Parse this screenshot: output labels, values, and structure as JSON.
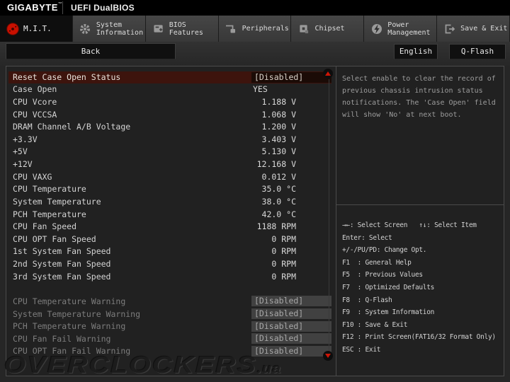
{
  "titlebar": {
    "brand": "GIGABYTE",
    "trademark": "™",
    "title": "UEFI DualBIOS"
  },
  "tabs": [
    {
      "label": "M.I.T.",
      "lines": [
        "M.I.T."
      ],
      "icon": "mit-dial-icon",
      "active": true
    },
    {
      "label": "System Information",
      "lines": [
        "System",
        "Information"
      ],
      "icon": "gear-icon",
      "active": false
    },
    {
      "label": "BIOS Features",
      "lines": [
        "BIOS",
        "Features"
      ],
      "icon": "bios-features-icon",
      "active": false
    },
    {
      "label": "Peripherals",
      "lines": [
        "Peripherals"
      ],
      "icon": "peripherals-icon",
      "active": false
    },
    {
      "label": "Chipset",
      "lines": [
        "Chipset"
      ],
      "icon": "chipset-icon",
      "active": false
    },
    {
      "label": "Power Management",
      "lines": [
        "Power",
        "Management"
      ],
      "icon": "power-icon",
      "active": false
    },
    {
      "label": "Save & Exit",
      "lines": [
        "Save & Exit"
      ],
      "icon": "save-exit-icon",
      "active": false
    }
  ],
  "toolbar": {
    "back": "Back",
    "language": "English",
    "qflash": "Q-Flash"
  },
  "rows": [
    {
      "label": "Reset Case Open Status",
      "value": "[Disabled]",
      "style": "selected"
    },
    {
      "label": "Case Open",
      "value": "YES",
      "style": "plain"
    },
    {
      "label": "CPU Vcore",
      "value": "1.188 V",
      "style": "reading"
    },
    {
      "label": "CPU VCCSA",
      "value": "1.068 V",
      "style": "reading"
    },
    {
      "label": "DRAM Channel A/B Voltage",
      "value": "1.200 V",
      "style": "reading"
    },
    {
      "label": "+3.3V",
      "value": "3.403 V",
      "style": "reading"
    },
    {
      "label": "+5V",
      "value": "5.130 V",
      "style": "reading"
    },
    {
      "label": "+12V",
      "value": "12.168 V",
      "style": "reading"
    },
    {
      "label": "CPU VAXG",
      "value": "0.012 V",
      "style": "reading"
    },
    {
      "label": "CPU Temperature",
      "value": "35.0 °C",
      "style": "reading"
    },
    {
      "label": "System Temperature",
      "value": "38.0 °C",
      "style": "reading"
    },
    {
      "label": "PCH Temperature",
      "value": "42.0 °C",
      "style": "reading"
    },
    {
      "label": "CPU Fan Speed",
      "value": "1188 RPM",
      "style": "reading"
    },
    {
      "label": "CPU OPT Fan Speed",
      "value": "0 RPM",
      "style": "reading"
    },
    {
      "label": "1st System Fan Speed",
      "value": "0 RPM",
      "style": "reading"
    },
    {
      "label": "2nd System Fan Speed",
      "value": "0 RPM",
      "style": "reading"
    },
    {
      "label": "3rd System Fan Speed",
      "value": "0 RPM",
      "style": "reading"
    },
    {
      "label": "",
      "value": "",
      "style": "spacer"
    },
    {
      "label": "CPU Temperature Warning",
      "value": "[Disabled]",
      "style": "boxed"
    },
    {
      "label": "System Temperature Warning",
      "value": "[Disabled]",
      "style": "boxed"
    },
    {
      "label": "PCH Temperature Warning",
      "value": "[Disabled]",
      "style": "boxed"
    },
    {
      "label": "CPU Fan Fail Warning",
      "value": "[Disabled]",
      "style": "boxed"
    },
    {
      "label": "CPU OPT Fan Fail Warning",
      "value": "[Disabled]",
      "style": "boxed"
    }
  ],
  "help": {
    "text": "Select enable to clear the record of previous chassis intrusion status notifications. The 'Case Open' field will show 'No' at next boot."
  },
  "legend": {
    "lines": [
      "→←: Select Screen   ↑↓: Select Item",
      "Enter: Select",
      "+/-/PU/PD: Change Opt.",
      "F1  : General Help",
      "F5  : Previous Values",
      "F7  : Optimized Defaults",
      "F8  : Q-Flash",
      "F9  : System Information",
      "F10 : Save & Exit",
      "F12 : Print Screen(FAT16/32 Format Only)",
      "ESC : Exit"
    ]
  },
  "watermark": {
    "main": "OVERCLOCKERS",
    "suffix": ".ua"
  },
  "colors": {
    "accent_red": "#c91000",
    "selected_row": "#3d140d",
    "disabled_box": "#414141",
    "frame_border": "#4b4b4b"
  }
}
